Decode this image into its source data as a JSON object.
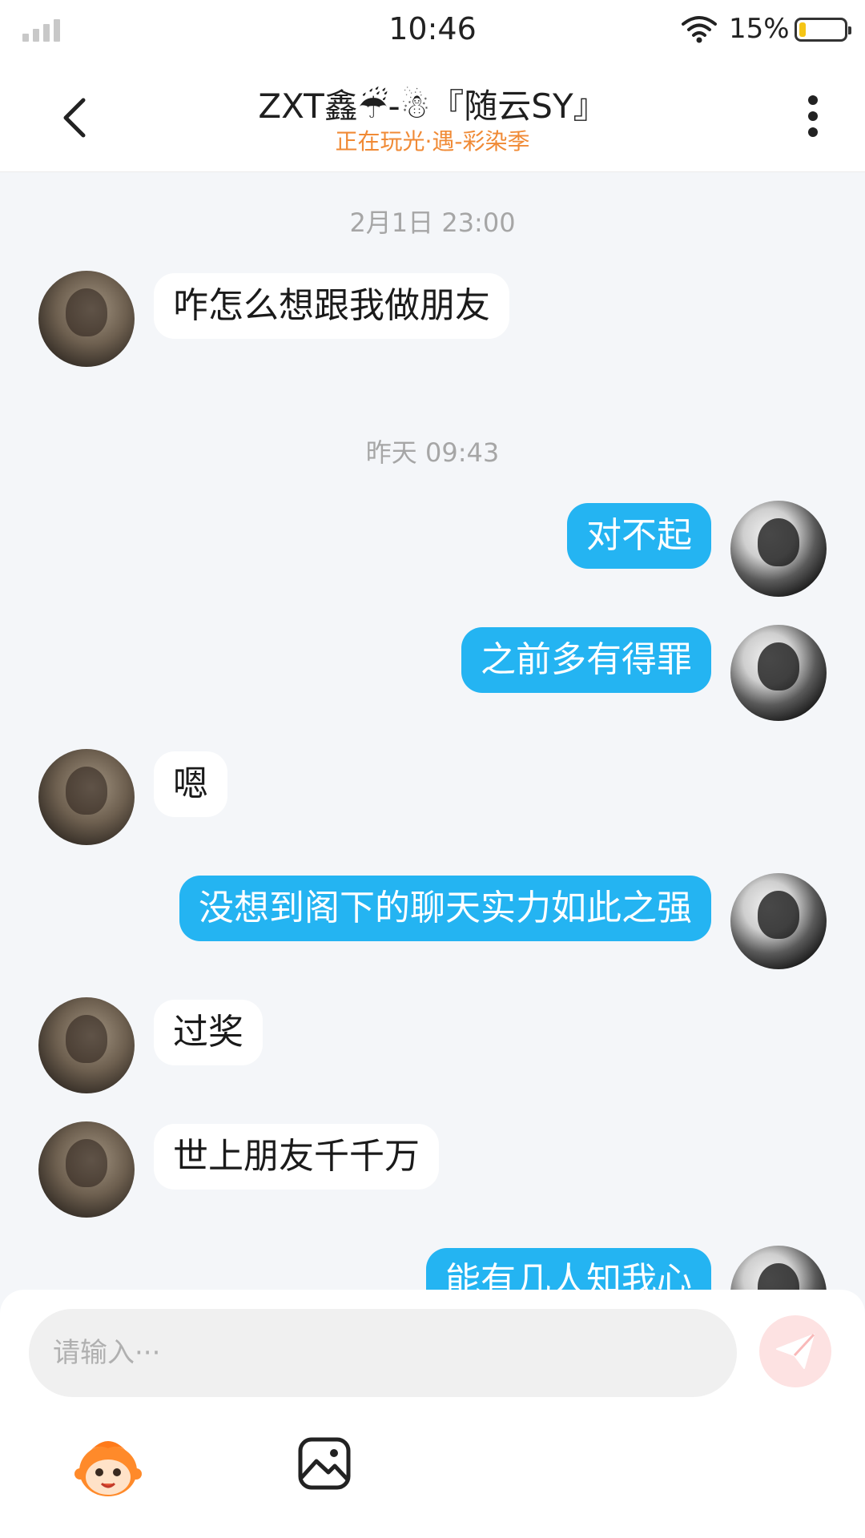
{
  "status_bar": {
    "time": "10:46",
    "battery_percent": "15%",
    "battery_level": 0.15
  },
  "header": {
    "contact_name": "ZXT鑫☔-☃『随云SY』",
    "contact_status": "正在玩光·遇-彩染季"
  },
  "messages": [
    {
      "type": "timestamp",
      "text": "2月1日 23:00"
    },
    {
      "type": "in",
      "text": "咋怎么想跟我做朋友"
    },
    {
      "type": "timestamp",
      "text": "昨天 09:43"
    },
    {
      "type": "out",
      "text": "对不起"
    },
    {
      "type": "out",
      "text": "之前多有得罪"
    },
    {
      "type": "in",
      "text": "嗯"
    },
    {
      "type": "out",
      "text": "没想到阁下的聊天实力如此之强"
    },
    {
      "type": "in",
      "text": "过奖"
    },
    {
      "type": "in",
      "text": "世上朋友千千万"
    },
    {
      "type": "out",
      "text": "能有几人知我心"
    }
  ],
  "composer": {
    "placeholder": "请输入···"
  },
  "colors": {
    "outgoing_bubble": "#24b4f2",
    "incoming_bubble": "#ffffff",
    "status_accent": "#f08a35",
    "send_button": "#fde2e2"
  },
  "icons": [
    "back-arrow-icon",
    "more-icon",
    "send-icon",
    "emoji-icon",
    "image-icon",
    "wifi-icon",
    "battery-icon",
    "signal-icon"
  ]
}
